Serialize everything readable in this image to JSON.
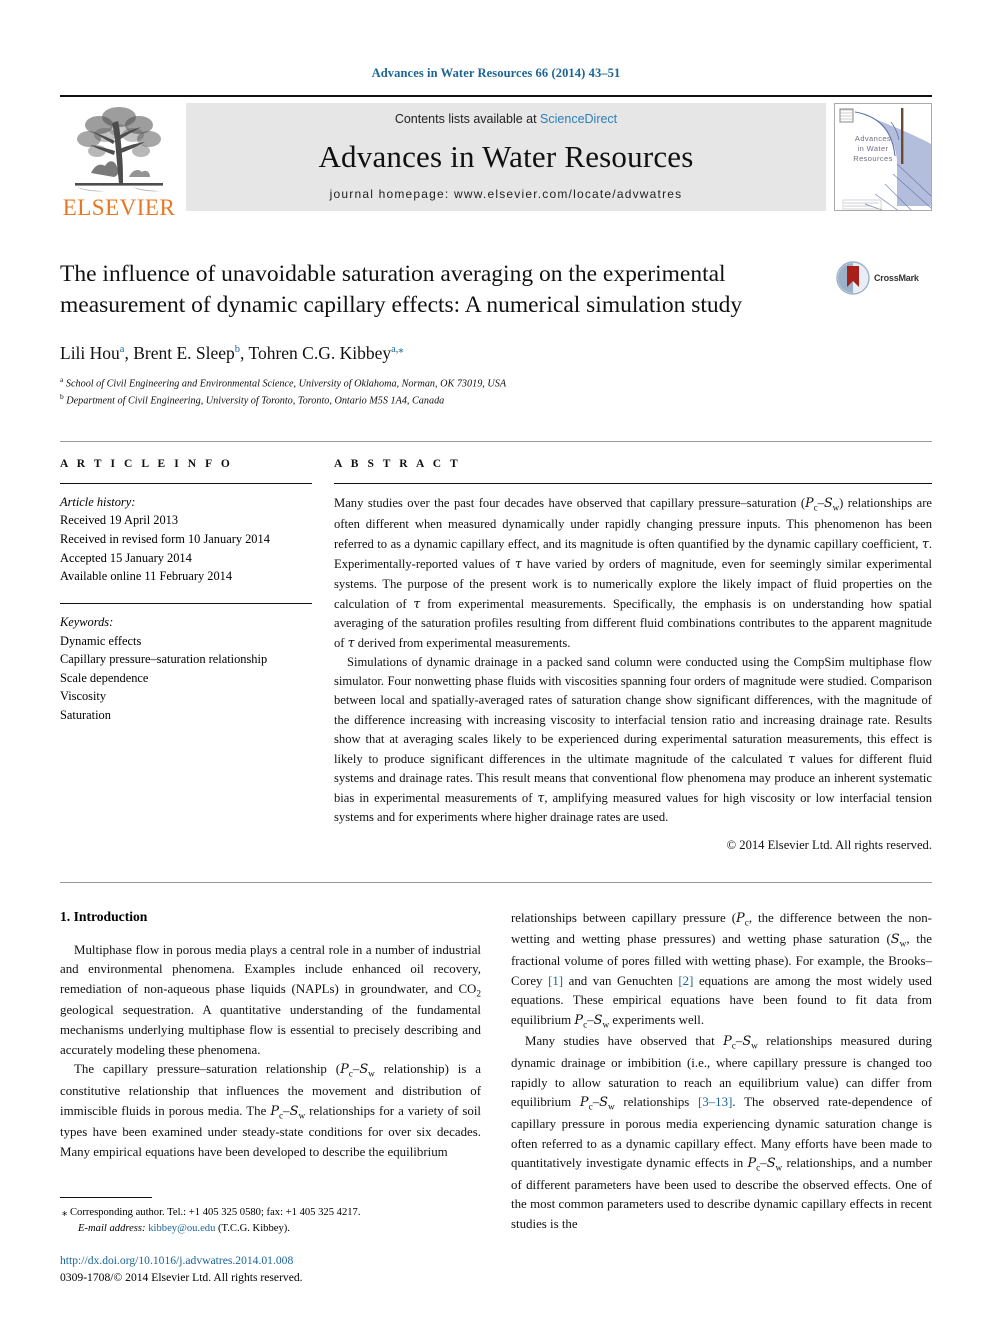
{
  "running_head": "Advances in Water Resources 66 (2014) 43–51",
  "masthead": {
    "publisher_word": "ELSEVIER",
    "contents_prefix": "Contents lists available at ",
    "contents_link": "ScienceDirect",
    "journal_name": "Advances in Water Resources",
    "homepage": "journal homepage: www.elsevier.com/locate/advwatres",
    "cover_title_line1": "Advances",
    "cover_title_line2": "in Water",
    "cover_title_line3": "Resources"
  },
  "crossmark": {
    "label": "CrossMark"
  },
  "article": {
    "title": "The influence of unavoidable saturation averaging on the experimental measurement of dynamic capillary effects: A numerical simulation study",
    "authors_plain": "Lili Hou a, Brent E. Sleep b, Tohren C.G. Kibbey a,*",
    "authors": [
      {
        "name": "Lili Hou",
        "marks": "a"
      },
      {
        "name": "Brent E. Sleep",
        "marks": "b"
      },
      {
        "name": "Tohren C.G. Kibbey",
        "marks": "a,*"
      }
    ],
    "affiliations": [
      {
        "mark": "a",
        "text": "School of Civil Engineering and Environmental Science, University of Oklahoma, Norman, OK 73019, USA"
      },
      {
        "mark": "b",
        "text": "Department of Civil Engineering, University of Toronto, Toronto, Ontario M5S 1A4, Canada"
      }
    ]
  },
  "info": {
    "heading": "A R T I C L E  I N F O",
    "history_label": "Article history:",
    "history": [
      "Received 19 April 2013",
      "Received in revised form 10 January 2014",
      "Accepted 15 January 2014",
      "Available online 11 February 2014"
    ],
    "keywords_label": "Keywords:",
    "keywords": [
      "Dynamic effects",
      "Capillary pressure–saturation relationship",
      "Scale dependence",
      "Viscosity",
      "Saturation"
    ]
  },
  "abstract": {
    "heading": "A B S T R A C T",
    "paragraph1": "Many studies over the past four decades have observed that capillary pressure–saturation (Pc–Sw) relationships are often different when measured dynamically under rapidly changing pressure inputs. This phenomenon has been referred to as a dynamic capillary effect, and its magnitude is often quantified by the dynamic capillary coefficient, τ. Experimentally-reported values of τ have varied by orders of magnitude, even for seemingly similar experimental systems. The purpose of the present work is to numerically explore the likely impact of fluid properties on the calculation of τ from experimental measurements. Specifically, the emphasis is on understanding how spatial averaging of the saturation profiles resulting from different fluid combinations contributes to the apparent magnitude of τ derived from experimental measurements.",
    "paragraph2": "Simulations of dynamic drainage in a packed sand column were conducted using the CompSim multiphase flow simulator. Four nonwetting phase fluids with viscosities spanning four orders of magnitude were studied. Comparison between local and spatially-averaged rates of saturation change show significant differences, with the magnitude of the difference increasing with increasing viscosity to interfacial tension ratio and increasing drainage rate. Results show that at averaging scales likely to be experienced during experimental saturation measurements, this effect is likely to produce significant differences in the ultimate magnitude of the calculated τ values for different fluid systems and drainage rates. This result means that conventional flow phenomena may produce an inherent systematic bias in experimental measurements of τ, amplifying measured values for high viscosity or low interfacial tension systems and for experiments where higher drainage rates are used.",
    "copyright": "© 2014 Elsevier Ltd. All rights reserved."
  },
  "introduction": {
    "heading": "1. Introduction",
    "left_p1": "Multiphase flow in porous media plays a central role in a number of industrial and environmental phenomena. Examples include enhanced oil recovery, remediation of non-aqueous phase liquids (NAPLs) in groundwater, and CO2 geological sequestration. A quantitative understanding of the fundamental mechanisms underlying multiphase flow is essential to precisely describing and accurately modeling these phenomena.",
    "left_p2": "The capillary pressure–saturation relationship (Pc–Sw relationship) is a constitutive relationship that influences the movement and distribution of immiscible fluids in porous media. The Pc–Sw relationships for a variety of soil types have been examined under steady-state conditions for over six decades. Many empirical equations have been developed to describe the equilibrium",
    "right_p1": "relationships between capillary pressure (Pc, the difference between the non-wetting and wetting phase pressures) and wetting phase saturation (Sw, the fractional volume of pores filled with wetting phase). For example, the Brooks–Corey [1] and van Genuchten [2] equations are among the most widely used equations. These empirical equations have been found to fit data from equilibrium Pc–Sw experiments well.",
    "right_p2": "Many studies have observed that Pc–Sw relationships measured during dynamic drainage or imbibition (i.e., where capillary pressure is changed too rapidly to allow saturation to reach an equilibrium value) can differ from equilibrium Pc–Sw relationships [3–13]. The observed rate-dependence of capillary pressure in porous media experiencing dynamic saturation change is often referred to as a dynamic capillary effect. Many efforts have been made to quantitatively investigate dynamic effects in Pc–Sw relationships, and a number of different parameters have been used to describe the observed effects. One of the most common parameters used to describe dynamic capillary effects in recent studies is the",
    "ref_1": "[1]",
    "ref_2": "[2]",
    "ref_3_13": "[3–13]"
  },
  "footnote": {
    "star": "⁎",
    "corresponding": "Corresponding author. Tel.: +1 405 325 0580; fax: +1 405 325 4217.",
    "email_label": "E-mail address:",
    "email": "kibbey@ou.edu",
    "email_owner": "(T.C.G. Kibbey)."
  },
  "footer": {
    "doi": "http://dx.doi.org/10.1016/j.advwatres.2014.01.008",
    "issn_copyright": "0309-1708/© 2014 Elsevier Ltd. All rights reserved."
  },
  "colors": {
    "link": "#1a6496",
    "sciencedirect": "#2a7fb8",
    "elsevier_orange": "#E87722",
    "band_bg": "#e6e6e6"
  }
}
